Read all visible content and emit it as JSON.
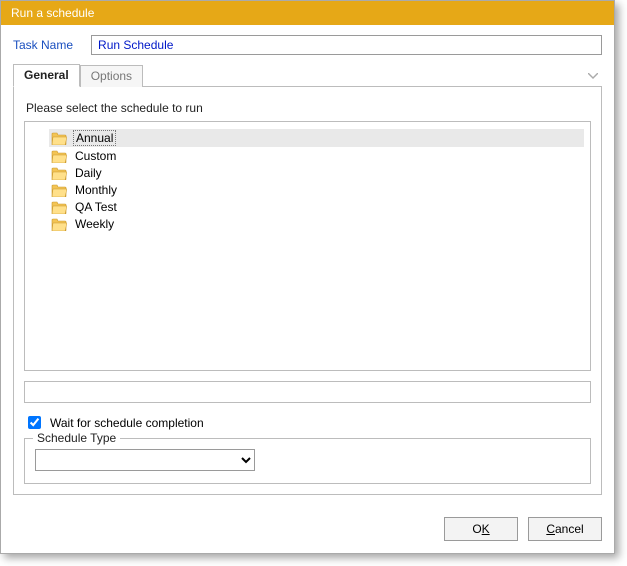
{
  "window": {
    "title": "Run a schedule"
  },
  "task": {
    "label": "Task Name",
    "value": "Run Schedule"
  },
  "tabs": {
    "general": "General",
    "options": "Options"
  },
  "panel": {
    "instruction": "Please select the schedule to run"
  },
  "schedules": [
    {
      "label": "Annual",
      "selected": true
    },
    {
      "label": "Custom",
      "selected": false
    },
    {
      "label": "Daily",
      "selected": false
    },
    {
      "label": "Monthly",
      "selected": false
    },
    {
      "label": "QA Test",
      "selected": false
    },
    {
      "label": "Weekly",
      "selected": false
    }
  ],
  "wait_checkbox": {
    "label": "Wait for schedule completion",
    "checked": true
  },
  "schedule_type": {
    "label": "Schedule Type",
    "value": ""
  },
  "buttons": {
    "ok_pre": "O",
    "ok_key": "K",
    "cancel_key": "C",
    "cancel_post": "ancel"
  }
}
